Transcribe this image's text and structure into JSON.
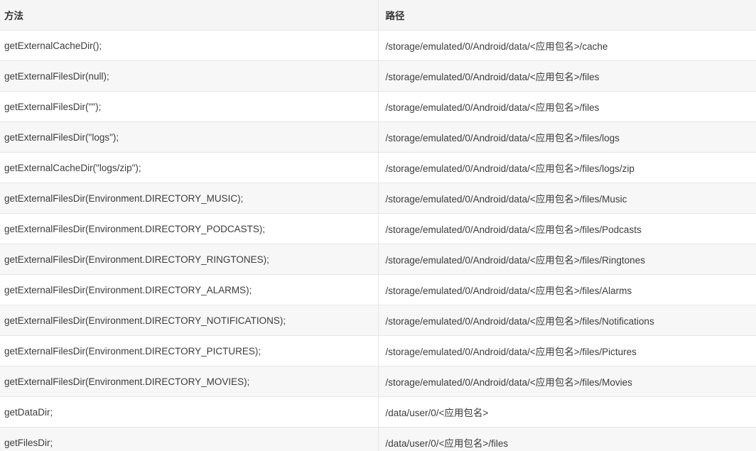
{
  "table": {
    "headers": [
      "方法",
      "路径"
    ],
    "rows": [
      [
        "getExternalCacheDir();",
        "/storage/emulated/0/Android/data/<应用包名>/cache"
      ],
      [
        "getExternalFilesDir(null);",
        "/storage/emulated/0/Android/data/<应用包名>/files"
      ],
      [
        "getExternalFilesDir(\"\");",
        "/storage/emulated/0/Android/data/<应用包名>/files"
      ],
      [
        "getExternalFilesDir(\"logs\");",
        "/storage/emulated/0/Android/data/<应用包名>/files/logs"
      ],
      [
        "getExternalCacheDir(\"logs/zip\");",
        "/storage/emulated/0/Android/data/<应用包名>/files/logs/zip"
      ],
      [
        "getExternalFilesDir(Environment.DIRECTORY_MUSIC);",
        "/storage/emulated/0/Android/data/<应用包名>/files/Music"
      ],
      [
        "getExternalFilesDir(Environment.DIRECTORY_PODCASTS);",
        "/storage/emulated/0/Android/data/<应用包名>/files/Podcasts"
      ],
      [
        "getExternalFilesDir(Environment.DIRECTORY_RINGTONES);",
        "/storage/emulated/0/Android/data/<应用包名>/files/Ringtones"
      ],
      [
        "getExternalFilesDir(Environment.DIRECTORY_ALARMS);",
        "/storage/emulated/0/Android/data/<应用包名>/files/Alarms"
      ],
      [
        "getExternalFilesDir(Environment.DIRECTORY_NOTIFICATIONS);",
        "/storage/emulated/0/Android/data/<应用包名>/files/Notifications"
      ],
      [
        "getExternalFilesDir(Environment.DIRECTORY_PICTURES);",
        "/storage/emulated/0/Android/data/<应用包名>/files/Pictures"
      ],
      [
        "getExternalFilesDir(Environment.DIRECTORY_MOVIES);",
        "/storage/emulated/0/Android/data/<应用包名>/files/Movies"
      ],
      [
        "getDataDir;",
        "/data/user/0/<应用包名>"
      ],
      [
        "getFilesDir;",
        "/data/user/0/<应用包名>/files"
      ]
    ]
  }
}
